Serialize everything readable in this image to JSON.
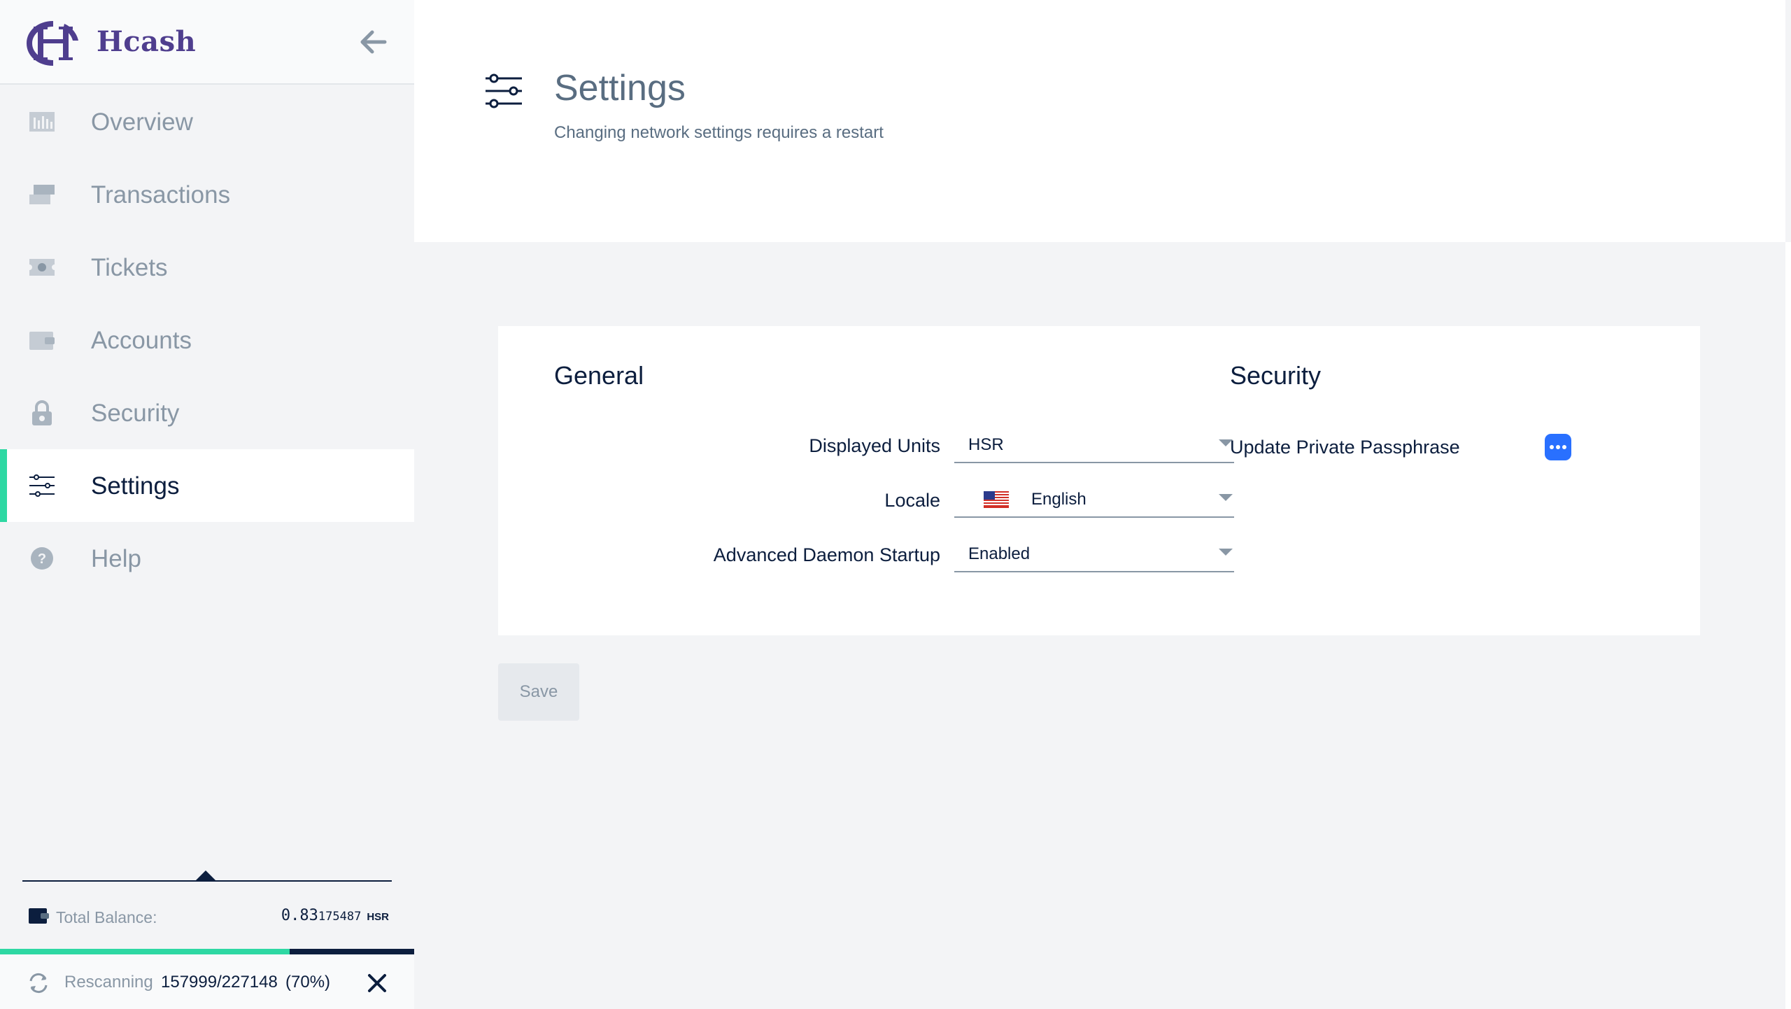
{
  "app": {
    "name": "Hcash"
  },
  "sidebar": {
    "items": [
      {
        "label": "Overview",
        "icon": "overview-icon"
      },
      {
        "label": "Transactions",
        "icon": "transactions-icon"
      },
      {
        "label": "Tickets",
        "icon": "tickets-icon"
      },
      {
        "label": "Accounts",
        "icon": "accounts-icon"
      },
      {
        "label": "Security",
        "icon": "lock-icon"
      },
      {
        "label": "Settings",
        "icon": "settings-sliders-icon",
        "active": true
      },
      {
        "label": "Help",
        "icon": "help-icon"
      }
    ],
    "balance": {
      "label": "Total Balance:",
      "value_main": "0.83",
      "value_small": "175487",
      "unit": "HSR"
    },
    "rescan": {
      "label": "Rescanning",
      "progress": "157999/227148",
      "percent": "(70%)",
      "fraction": 0.7
    }
  },
  "header": {
    "title": "Settings",
    "subtitle": "Changing network settings requires a restart"
  },
  "general": {
    "title": "General",
    "displayed_units": {
      "label": "Displayed Units",
      "value": "HSR"
    },
    "locale": {
      "label": "Locale",
      "value": "English"
    },
    "daemon": {
      "label": "Advanced Daemon Startup",
      "value": "Enabled"
    }
  },
  "security": {
    "title": "Security",
    "passphrase_label": "Update Private Passphrase"
  },
  "save_label": "Save",
  "colors": {
    "accent_green": "#2ed8a3",
    "brand_purple": "#4f3e8e",
    "navy": "#0c1e3e",
    "blue_button": "#2970ff"
  }
}
